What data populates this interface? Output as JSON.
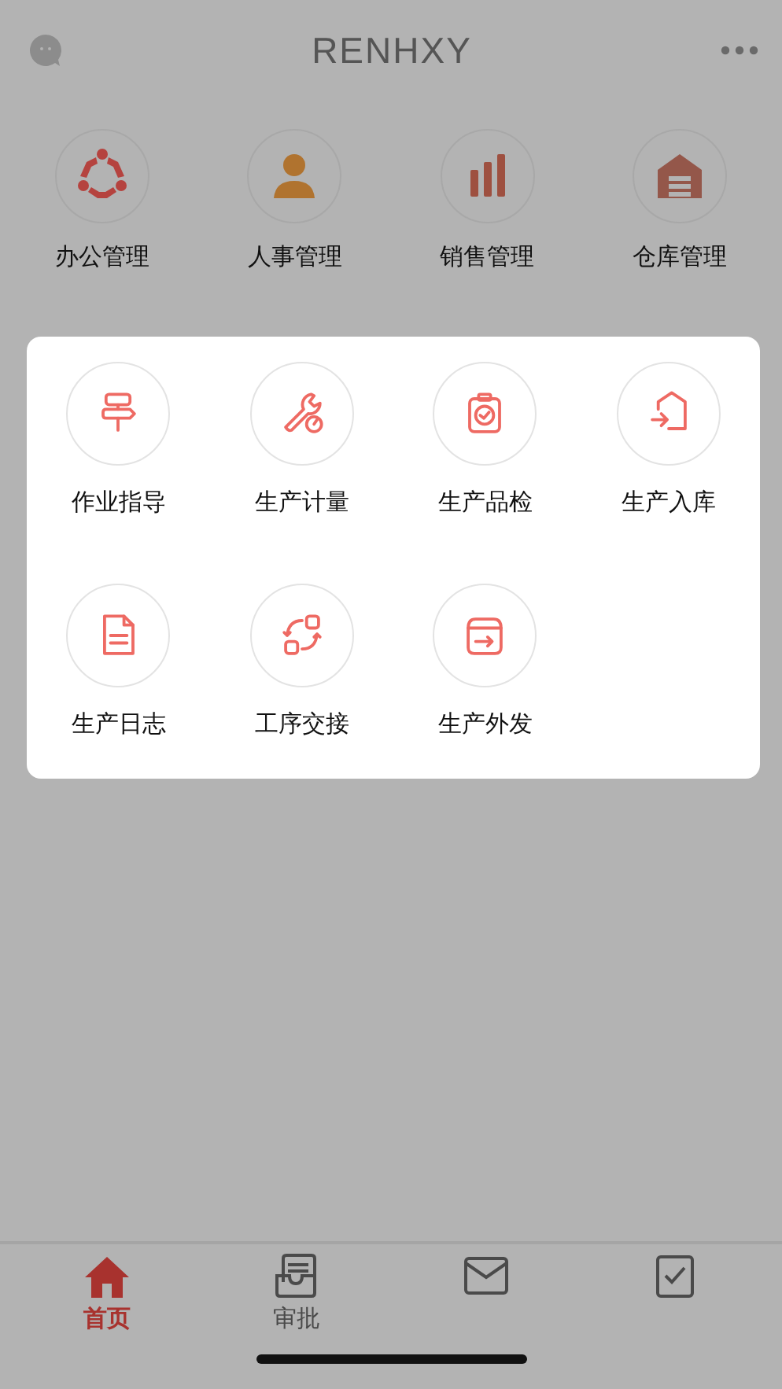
{
  "header": {
    "title": "RENHXY"
  },
  "modules": [
    {
      "label": "办公管理"
    },
    {
      "label": "人事管理"
    },
    {
      "label": "销售管理"
    },
    {
      "label": "仓库管理"
    }
  ],
  "popup": {
    "items": [
      {
        "label": "作业指导"
      },
      {
        "label": "生产计量"
      },
      {
        "label": "生产品检"
      },
      {
        "label": "生产入库"
      },
      {
        "label": "生产日志"
      },
      {
        "label": "工序交接"
      },
      {
        "label": "生产外发"
      }
    ]
  },
  "tab_bar": {
    "tabs": [
      {
        "label": "首页",
        "selected": true
      },
      {
        "label": "审批",
        "selected": false
      },
      {
        "selected": false
      },
      {
        "selected": false
      }
    ]
  }
}
